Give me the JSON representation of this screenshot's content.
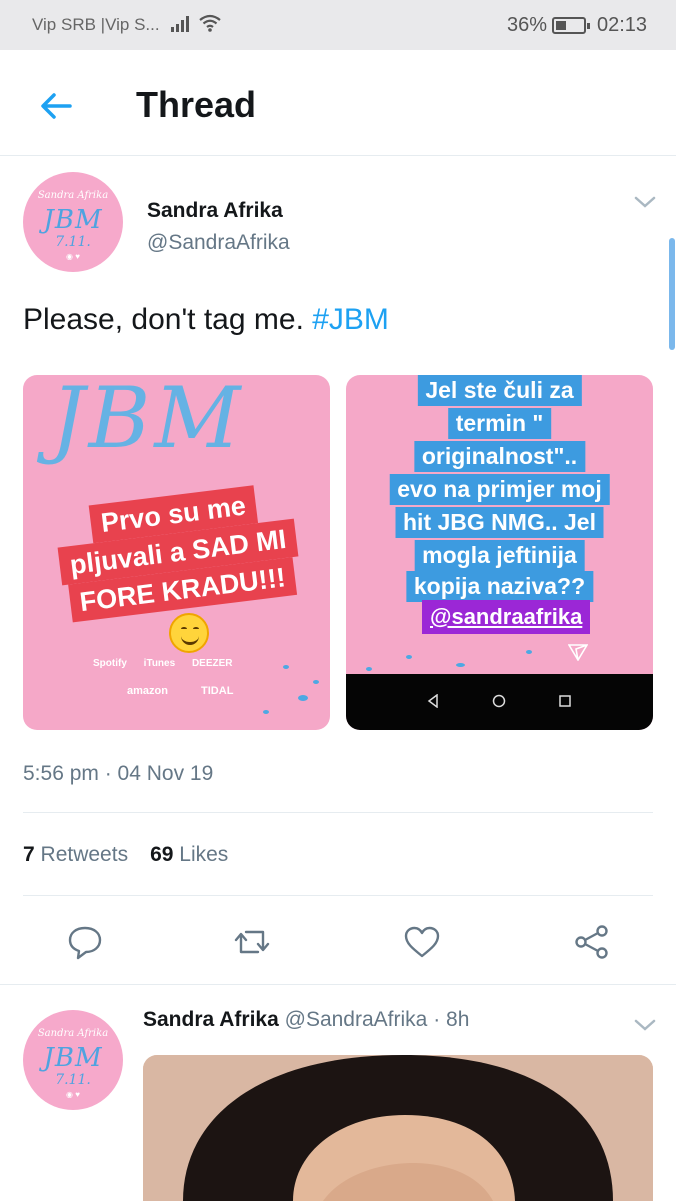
{
  "status_bar": {
    "carrier": "Vip SRB |Vip S...",
    "battery": "36%",
    "time": "02:13"
  },
  "header": {
    "title": "Thread"
  },
  "avatar": {
    "top": "Sandra Afrika",
    "main": "JBM",
    "sub": "7.11."
  },
  "tweet": {
    "author_name": "Sandra Afrika",
    "author_handle": "@SandraAfrika",
    "text": "Please, don't tag me. ",
    "hashtag": "#JBM",
    "timestamp": "5:56 pm · 04 Nov 19",
    "retweets_count": "7",
    "retweets_label": "Retweets",
    "likes_count": "69",
    "likes_label": "Likes",
    "media": {
      "left": {
        "headline": "JBM",
        "sticker_lines": [
          "Prvo su me",
          "pljuvali a SAD MI",
          "FORE KRADU!!!"
        ],
        "logos_row1": [
          "Spotify",
          "iTunes",
          "DEEZER"
        ],
        "logos_row2": [
          "amazon",
          "TIDAL"
        ]
      },
      "right": {
        "lines": [
          "Jel ste čuli za",
          "termin \"",
          "originalnost\"..",
          "evo na primjer moj",
          "hit JBG NMG.. Jel",
          "mogla jeftinija",
          "kopija naziva??"
        ],
        "mention": "@sandraafrika"
      }
    }
  },
  "reply": {
    "author_name": "Sandra Afrika",
    "author_handle": "@SandraAfrika",
    "time": "· 8h"
  },
  "colors": {
    "accent": "#1da1f2",
    "pink": "#f5a8c8",
    "text_secondary": "#657786"
  }
}
